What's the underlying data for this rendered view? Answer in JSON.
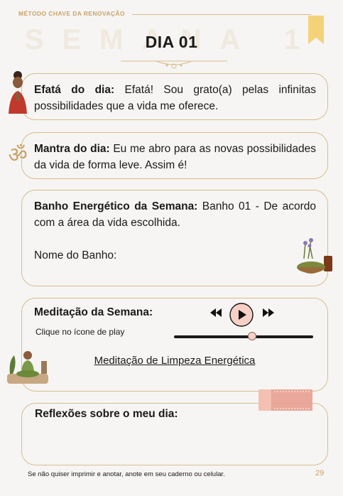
{
  "header": {
    "label": "MÉTODO CHAVE DA RENOVAÇÃO",
    "watermark": "SEMANA 1",
    "title": "DIA 01"
  },
  "efata": {
    "label": "Efatá do dia:",
    "text": " Efatá! Sou grato(a) pelas infinitas possibilidades que a vida me oferece."
  },
  "mantra": {
    "label": "Mantra do dia:",
    "text": " Eu me abro para as novas possibilidades da vida de forma leve. Assim é!"
  },
  "banho": {
    "label": "Banho Energético da Semana:",
    "text": " Banho 01 - De acordo com a área da vida escolhida.",
    "name_label": "Nome do Banho:"
  },
  "meditacao": {
    "title": "Meditação da Semana:",
    "hint": "Clique no ícone de play",
    "link": "Meditação de Limpeza Energética",
    "progress": 0.56
  },
  "reflexoes": {
    "title": "Reflexões sobre o meu dia:"
  },
  "footer": {
    "note": "Se não quiser imprimir e anotar, anote em seu caderno ou celular.",
    "page": "29"
  },
  "colors": {
    "gold": "#c9a36a",
    "border": "#d8bd8e",
    "accent_pink": "#e8a090"
  }
}
